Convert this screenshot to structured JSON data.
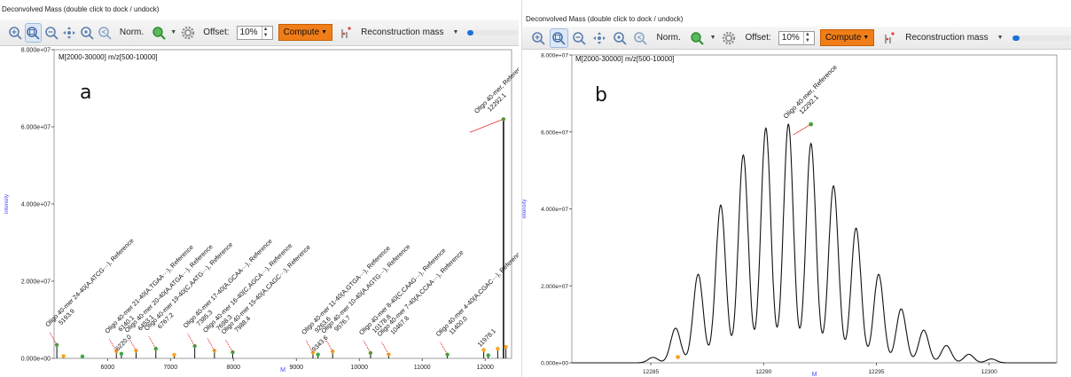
{
  "panels": [
    {
      "letter": "a",
      "window_title": "Deconvolved Mass (double click to dock / undock)",
      "toolbar": {
        "norm_label": "Norm.",
        "offset_label": "Offset:",
        "offset_value": "10%",
        "compute_label": "Compute",
        "reconstruction_label": "Reconstruction mass",
        "slider_fraction": 0.12
      },
      "chart_data": {
        "type": "bar",
        "subtitle": "M[2000-30000] m/z[500-10000]",
        "xlabel": "M",
        "ylabel": "intensity",
        "xlim": [
          5150,
          12420
        ],
        "ylim": [
          0,
          80000000
        ],
        "yticks": [
          "0.000e+00",
          "2.000e+07",
          "4.000e+07",
          "6.000e+07",
          "8.000e+07"
        ],
        "ytick_values": [
          0,
          20000000,
          40000000,
          60000000,
          80000000
        ],
        "xticks": [
          "6000",
          "7000",
          "8000",
          "9000",
          "10000",
          "11000",
          "12000"
        ],
        "xtick_values": [
          6000,
          7000,
          8000,
          9000,
          10000,
          11000,
          12000
        ],
        "grid": false,
        "labeled_peaks": [
          {
            "label": "Oligo 40-mer 24-40(A,ATCG···), Reference",
            "mass_text": "5193.9",
            "x": 5193.9,
            "y": 3500000
          },
          {
            "label": "Oligo 40-mer 21-40(A,TGAA···), Reference",
            "mass_text": "6140.1",
            "x": 6140.1,
            "y": 1800000
          },
          {
            "label": "Oligo 40-mer 20-40(A,ATGA···), Reference",
            "mass_text": "6453.1",
            "x": 6453.1,
            "y": 2000000
          },
          {
            "label": "Oligo 40-mer 19-40(C,AATG···), Reference",
            "mass_text": "6767.2",
            "x": 6767.2,
            "y": 2500000
          },
          {
            "label": "Oligo 40-mer 17-40(A,GCAA···), Reference",
            "mass_text": "7385.3",
            "x": 7385.3,
            "y": 3200000
          },
          {
            "label": "Oligo 40-mer 16-40(C,AGCA···), Reference",
            "mass_text": "7698.3",
            "x": 7698.3,
            "y": 2000000
          },
          {
            "label": "Oligo 40-mer 15-40(A,CAGC···), Reference",
            "mass_text": "7988.4",
            "x": 7988.4,
            "y": 1600000
          },
          {
            "label": "Oligo 40-mer 11-40(A,GTGA···), Reference",
            "mass_text": "9263.6",
            "x": 9263.6,
            "y": 1500000
          },
          {
            "label": "Oligo 40-mer 10-40(A,AGTG···), Reference",
            "mass_text": "9576.7",
            "x": 9576.7,
            "y": 1800000
          },
          {
            "label": "Oligo 40-mer 8-40(C,CAAG···), Reference",
            "mass_text": "10178.8",
            "x": 10178.8,
            "y": 1400000
          },
          {
            "label": "Oligo 40-mer 7-40(A,CCAA···), Reference",
            "mass_text": "10467.8",
            "x": 10467.8,
            "y": 1000000
          },
          {
            "label": "Oligo 40-mer 4-40(A,CGAC···), Reference",
            "mass_text": "11400.0",
            "x": 11400.0,
            "y": 1000000
          },
          {
            "label": "Oligo 40-mer, Reference",
            "mass_text": "12292.1",
            "x": 12292.1,
            "y": 62000000
          }
        ],
        "other_annotations": [
          {
            "text": "6220.0",
            "x": 6220.0,
            "y": 1200000
          },
          {
            "text": "9343.6",
            "x": 9343.6,
            "y": 1000000
          },
          {
            "text": "11978.1",
            "x": 11978.1,
            "y": 2200000
          }
        ],
        "peaks": [
          {
            "x": 5193.9,
            "y": 3500000
          },
          {
            "x": 5300,
            "y": 600000
          },
          {
            "x": 5600,
            "y": 500000
          },
          {
            "x": 6140.1,
            "y": 1800000
          },
          {
            "x": 6220.0,
            "y": 1200000
          },
          {
            "x": 6453.1,
            "y": 2000000
          },
          {
            "x": 6767.2,
            "y": 2500000
          },
          {
            "x": 7060,
            "y": 900000
          },
          {
            "x": 7385.3,
            "y": 3200000
          },
          {
            "x": 7698.3,
            "y": 2000000
          },
          {
            "x": 7988.4,
            "y": 1600000
          },
          {
            "x": 9263.6,
            "y": 1500000
          },
          {
            "x": 9343.6,
            "y": 1000000
          },
          {
            "x": 9576.7,
            "y": 1800000
          },
          {
            "x": 10178.8,
            "y": 1400000
          },
          {
            "x": 10467.8,
            "y": 1000000
          },
          {
            "x": 11400.0,
            "y": 1000000
          },
          {
            "x": 11978.1,
            "y": 2200000
          },
          {
            "x": 12050,
            "y": 800000
          },
          {
            "x": 12200,
            "y": 2500000
          },
          {
            "x": 12292.1,
            "y": 62000000
          },
          {
            "x": 12330,
            "y": 3000000
          }
        ]
      }
    },
    {
      "letter": "b",
      "window_title": "Deconvolved Mass (double click to dock / undock)",
      "toolbar": {
        "norm_label": "Norm.",
        "offset_label": "Offset:",
        "offset_value": "10%",
        "compute_label": "Compute",
        "reconstruction_label": "Reconstruction mass",
        "slider_fraction": 0.12
      },
      "chart_data": {
        "type": "line",
        "subtitle": "M[2000-30000] m/z[500-10000]",
        "xlabel": "M",
        "ylabel": "intensity",
        "xlim": [
          12281.5,
          12303
        ],
        "ylim": [
          0,
          80000000
        ],
        "yticks": [
          "0.000e+00",
          "2.000e+07",
          "4.000e+07",
          "6.000e+07",
          "8.000e+07"
        ],
        "ytick_values": [
          0,
          20000000,
          40000000,
          60000000,
          80000000
        ],
        "xticks": [
          "12285",
          "12290",
          "12295",
          "12300"
        ],
        "xtick_values": [
          12285,
          12290,
          12295,
          12300
        ],
        "grid": false,
        "labeled_peaks": [
          {
            "label": "Oligo 40-mer, Reference",
            "mass_text": "12292.1",
            "x": 12292.1,
            "y": 62000000
          }
        ],
        "isotope_peaks": [
          {
            "x": 12285.1,
            "y": 1400000
          },
          {
            "x": 12286.1,
            "y": 9000000
          },
          {
            "x": 12287.1,
            "y": 23000000
          },
          {
            "x": 12288.1,
            "y": 41000000
          },
          {
            "x": 12289.1,
            "y": 54000000
          },
          {
            "x": 12290.1,
            "y": 61000000
          },
          {
            "x": 12291.1,
            "y": 62000000
          },
          {
            "x": 12292.1,
            "y": 57000000
          },
          {
            "x": 12293.1,
            "y": 46000000
          },
          {
            "x": 12294.1,
            "y": 35000000
          },
          {
            "x": 12295.1,
            "y": 23000000
          },
          {
            "x": 12296.1,
            "y": 14000000
          },
          {
            "x": 12297.1,
            "y": 8500000
          },
          {
            "x": 12298.1,
            "y": 4500000
          },
          {
            "x": 12299.1,
            "y": 2200000
          },
          {
            "x": 12300.1,
            "y": 1000000
          }
        ],
        "markers": [
          {
            "x": 12286.2,
            "y": 1500000,
            "color": "#f5a623"
          },
          {
            "x": 12292.1,
            "y": 62000000,
            "color": "#3caa3c"
          }
        ]
      }
    }
  ]
}
